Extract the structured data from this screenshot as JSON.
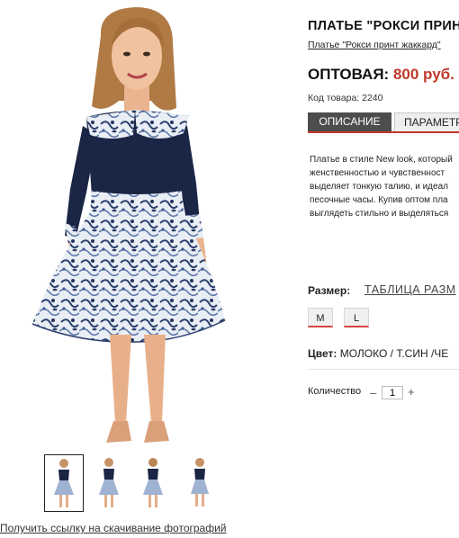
{
  "product": {
    "title": "ПЛАТЬЕ \"РОКСИ ПРИНТ",
    "subtitle": "Платье \"Рокси принт жаккард\"",
    "price_label": "ОПТОВАЯ:",
    "price_value": "800 руб.",
    "sku": "Код товара: 2240"
  },
  "tabs": [
    {
      "label": "ОПИСАНИЕ",
      "active": true
    },
    {
      "label": "ПАРАМЕТР",
      "active": false
    }
  ],
  "description_lines": [
    "Платье в стиле New look, который",
    "женственностью и чувственност",
    "выделяет тонкую талию, и идеал",
    "песочные часы. Купив оптом пла",
    "выглядеть стильно и выделяться"
  ],
  "size": {
    "label": "Размер:",
    "table_link": "ТАБЛИЦА РАЗМ",
    "options": [
      "M",
      "L"
    ]
  },
  "color": {
    "label": "Цвет:",
    "value": "МОЛОКО / Т.СИН /ЧЕ"
  },
  "quantity": {
    "label": "Количество",
    "minus": "–",
    "value": "1",
    "plus": "+"
  },
  "gallery": {
    "download_link": "Получить ссылку на скачивание фотографий",
    "thumbnail_count": 4,
    "selected_index": 0
  },
  "colors": {
    "accent": "#c0392b",
    "dress_navy": "#1b2545",
    "tab_active": "#4d4d4d"
  }
}
